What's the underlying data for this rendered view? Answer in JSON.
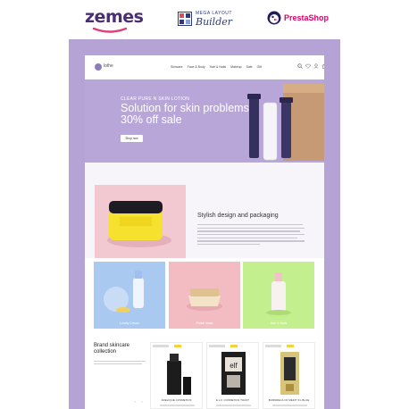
{
  "brands": {
    "zemes": "zemes",
    "builder_top": "MEGA LAYOUT",
    "builder_bottom": "Builder",
    "prestashop": "PrestaShop"
  },
  "store": {
    "logo_text": "lothe",
    "nav_links": [
      "Skincare",
      "Face & Body",
      "Hair & Nails",
      "Makeup",
      "Sale",
      "Gift"
    ],
    "icons": [
      "search-icon",
      "heart-icon",
      "user-icon",
      "cart-icon"
    ]
  },
  "hero": {
    "eyebrow": "CLEAR PURE N SKIN LOTION",
    "title": "Solution for skin problems 30% off sale",
    "button": "Shop now"
  },
  "feature": {
    "title": "Stylish design and packaging"
  },
  "categories": [
    {
      "label": "Lovely Cream"
    },
    {
      "label": "Facial mask"
    },
    {
      "label": "Hair & Nails"
    }
  ],
  "products": {
    "title": "Brand skincare collection",
    "items": [
      {
        "name": "ADELIQUE COSMETICS"
      },
      {
        "name": "E.L.F. COSMETICS TOAST"
      },
      {
        "name": "BURNRECA OF MEDIT S'L BLUE"
      }
    ]
  },
  "colors": {
    "frame": "#b6a3d6",
    "hero": "#b8a6d9",
    "brand_purple": "#4a2d73",
    "presta_pink": "#df0067"
  }
}
